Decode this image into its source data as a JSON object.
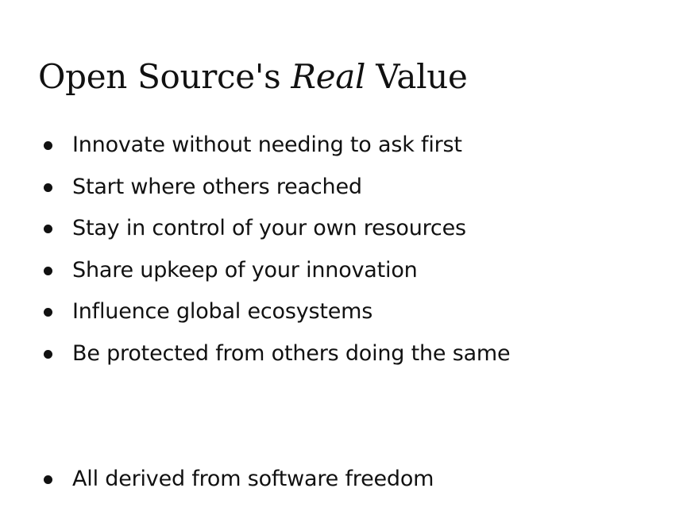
{
  "title": {
    "prefix": "Open Source's ",
    "emphasis": "Real",
    "suffix": " Value"
  },
  "bullets": [
    "Innovate without needing to ask first",
    "Start where others reached",
    "Stay in control of your own resources",
    "Share upkeep of your innovation",
    "Influence global ecosystems",
    "Be protected from others doing the same"
  ],
  "conclusion": "All derived from software freedom"
}
